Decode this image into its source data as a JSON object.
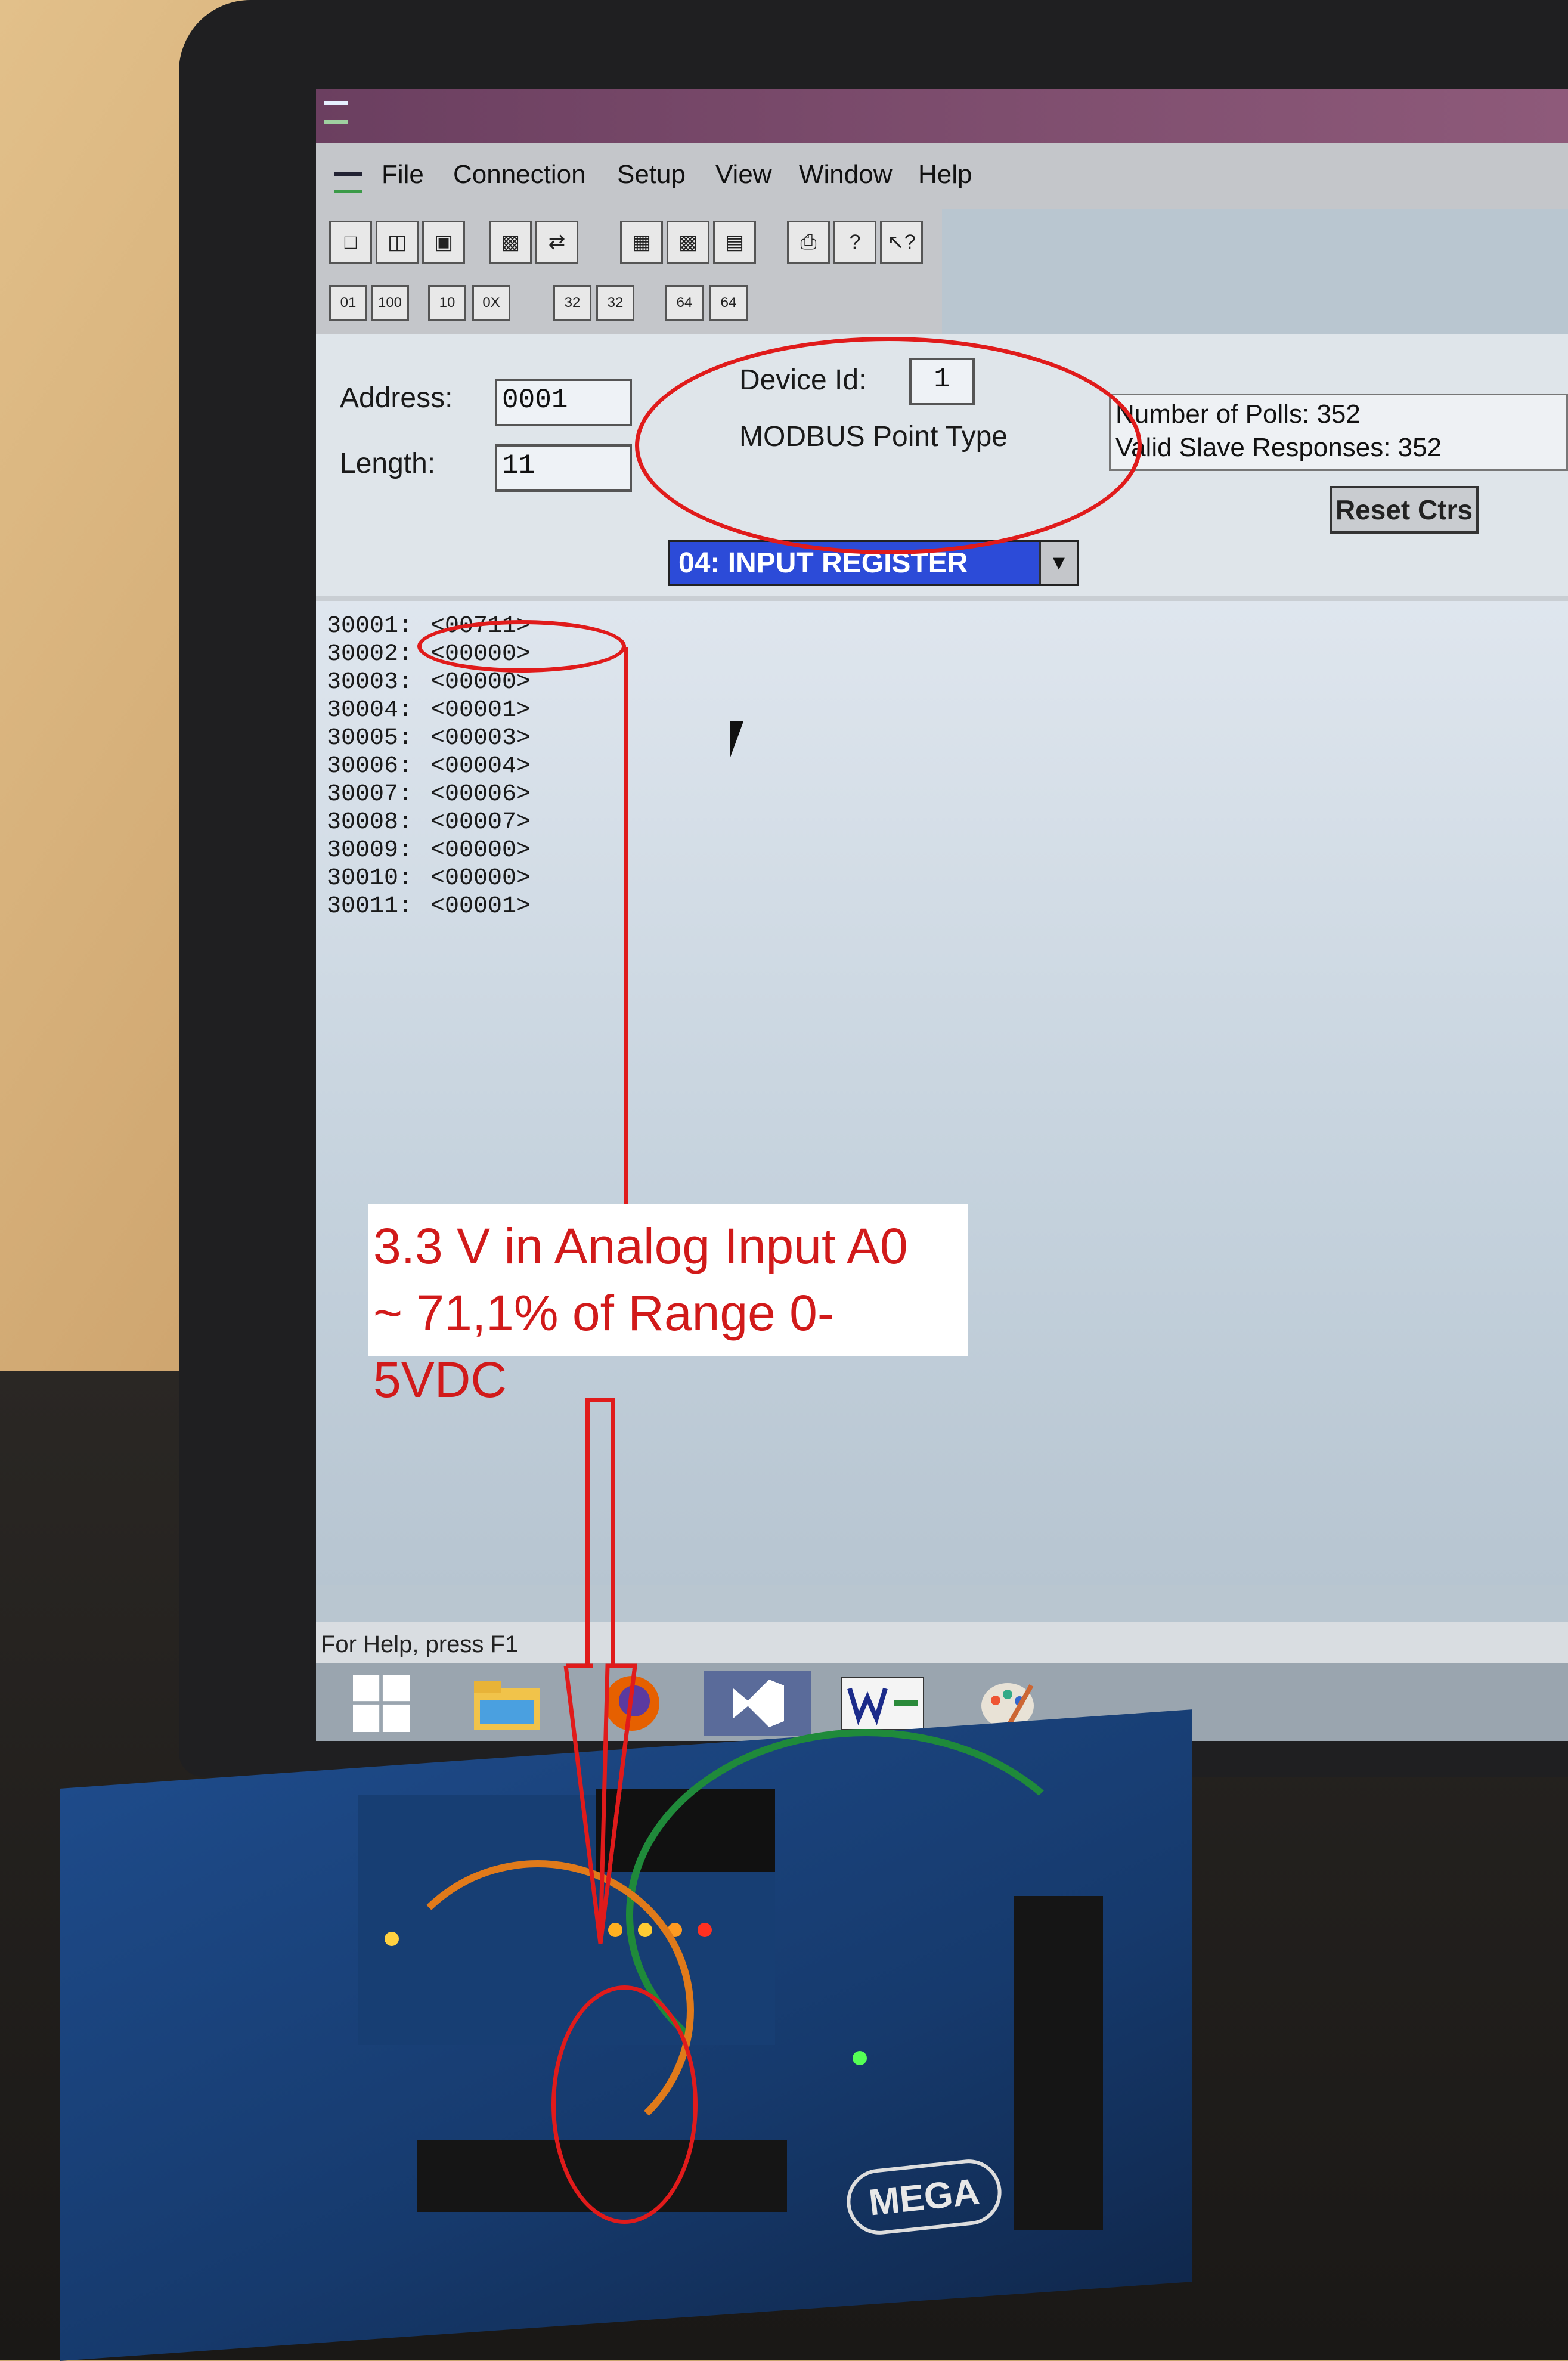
{
  "menubar": {
    "items": [
      "File",
      "Connection",
      "Setup",
      "View",
      "Window",
      "Help"
    ]
  },
  "toolbar": {
    "row2_labels": [
      "01",
      "100",
      "10",
      "0X",
      "32",
      "32",
      "64",
      "64"
    ]
  },
  "params": {
    "address_label": "Address:",
    "address_value": "0001",
    "length_label": "Length:",
    "length_value": "11",
    "device_id_label": "Device Id:",
    "device_id_value": "1",
    "point_type_label": "MODBUS Point Type",
    "point_type_value": "04: INPUT REGISTER",
    "polls_text": "Number of Polls: 352",
    "responses_text": "Valid Slave Responses: 352",
    "reset_label": "Reset Ctrs"
  },
  "registers": [
    {
      "addr": "30001:",
      "value": "<00711>"
    },
    {
      "addr": "30002:",
      "value": "<00000>"
    },
    {
      "addr": "30003:",
      "value": "<00000>"
    },
    {
      "addr": "30004:",
      "value": "<00001>"
    },
    {
      "addr": "30005:",
      "value": "<00003>"
    },
    {
      "addr": "30006:",
      "value": "<00004>"
    },
    {
      "addr": "30007:",
      "value": "<00006>"
    },
    {
      "addr": "30008:",
      "value": "<00007>"
    },
    {
      "addr": "30009:",
      "value": "<00000>"
    },
    {
      "addr": "30010:",
      "value": "<00000>"
    },
    {
      "addr": "30011:",
      "value": "<00001>"
    }
  ],
  "status": {
    "help_text": "For Help, press F1"
  },
  "annotation": {
    "line1": "3.3 V in Analog Input A0",
    "line2": "~ 71,1% of Range 0-5VDC"
  },
  "board": {
    "label": "MEGA"
  },
  "colors": {
    "annotation_red": "#e01b1b",
    "dropdown_blue": "#2c4bd8"
  },
  "icons": [
    "windows-start-icon",
    "file-explorer-icon",
    "firefox-icon",
    "visual-studio-icon",
    "wintech-icon",
    "paint-icon"
  ]
}
